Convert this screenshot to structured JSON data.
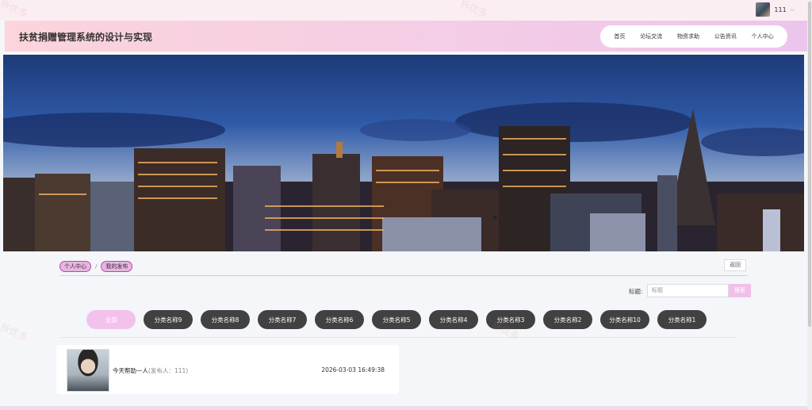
{
  "user": {
    "name": "111"
  },
  "header": {
    "title": "扶贫捐赠管理系统的设计与实现"
  },
  "nav": {
    "items": [
      "首页",
      "论坛交流",
      "物资求助",
      "公告资讯",
      "个人中心"
    ]
  },
  "breadcrumb": {
    "items": [
      "个人中心",
      "我的发布"
    ],
    "separator": "/"
  },
  "back_label": "返回",
  "search": {
    "label": "标题:",
    "placeholder": "标题",
    "button": "搜索"
  },
  "categories": [
    "全部",
    "分类名称9",
    "分类名称8",
    "分类名称7",
    "分类名称6",
    "分类名称5",
    "分类名称4",
    "分类名称3",
    "分类名称2",
    "分类名称10",
    "分类名称1"
  ],
  "active_category": "全部",
  "list": [
    {
      "title": "今天帮助一人",
      "publisher_prefix": "(发布人：",
      "publisher": "111",
      "publisher_suffix": ")",
      "time": "2026-03-03 16:49:38"
    }
  ],
  "watermark": "拆优多",
  "colors": {
    "accent": "#f3c2ec",
    "pill": "#414141",
    "header_start": "#fcd4dc",
    "header_end": "#ecc5ec"
  },
  "icons": {
    "cursor": "cursor-icon",
    "dropdown": "chevron-down-icon"
  }
}
